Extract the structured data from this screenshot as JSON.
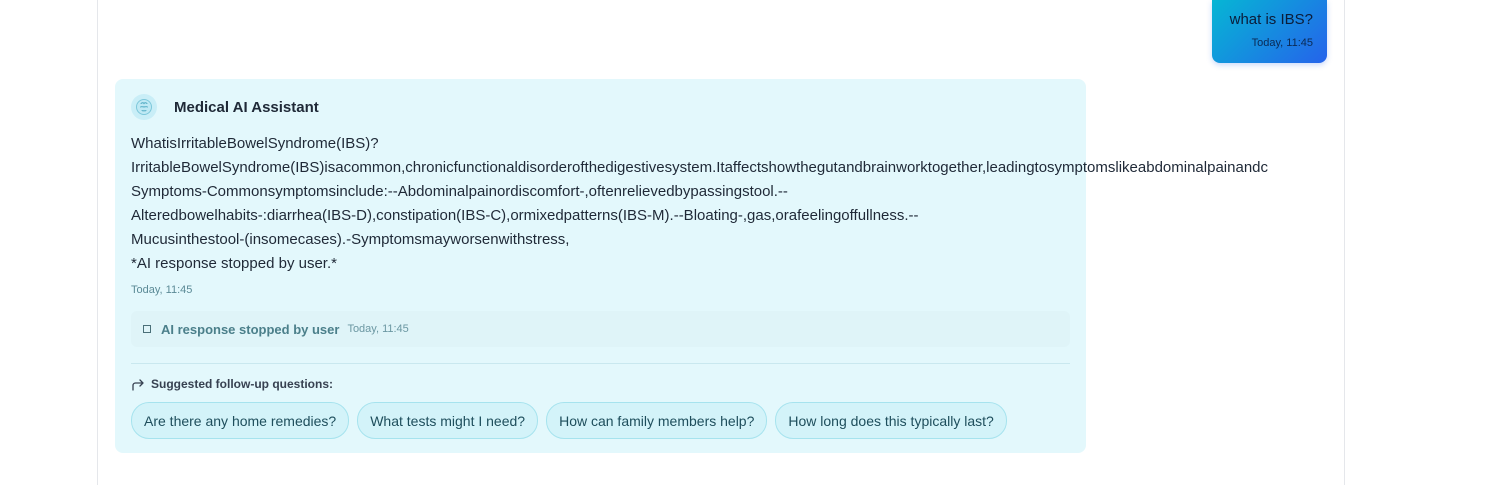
{
  "user_message": {
    "text": "what is IBS?",
    "time": "Today, 11:45"
  },
  "assistant": {
    "name": "Medical AI Assistant",
    "avatar_icon": "brain-icon",
    "lines": [
      "WhatisIrritableBowelSyndrome(IBS)?",
      "IrritableBowelSyndrome(IBS)isacommon,chronicfunctionaldisorderofthedigestivesystem.Itaffectshowthegutandbrainworktogether,leadingtosymptomslikeabdominalpainandc",
      "Symptoms-Commonsymptomsinclude:--Abdominalpainordiscomfort-,oftenrelievedbypassingstool.--",
      "Alteredbowelhabits-:diarrhea(IBS-D),constipation(IBS-C),ormixedpatterns(IBS-M).--Bloating-,gas,orafeelingoffullness.--",
      "Mucusinthestool-(insomecases).-Symptomsmayworsenwithstress,",
      "*AI response stopped by user.*"
    ],
    "time": "Today, 11:45",
    "stopped": {
      "icon": "stop-square-icon",
      "label": "AI response stopped by user",
      "time": "Today, 11:45"
    },
    "followups": {
      "icon": "reply-arrow-icon",
      "title": "Suggested follow-up questions:",
      "items": [
        "Are there any home remedies?",
        "What tests might I need?",
        "How can family members help?",
        "How long does this typically last?"
      ]
    }
  },
  "colors": {
    "user_bubble_start": "#06b6d4",
    "user_bubble_end": "#2563eb",
    "assistant_card": "#e3f8fc",
    "chip_border": "#a6e3ee"
  }
}
